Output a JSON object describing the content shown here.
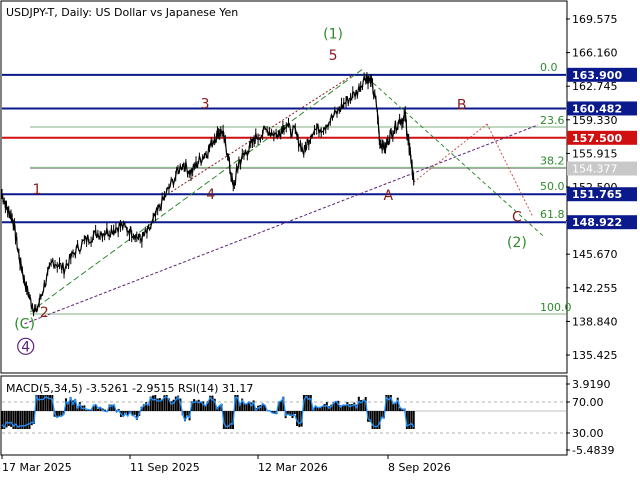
{
  "title": "USDJPY-T, Daily:  US Dollar vs Japanese Yen",
  "colors": {
    "navy": "#0a1a8c",
    "red": "#d01010",
    "green": "#2e8b2e",
    "darkred": "#8b1a1a",
    "purple": "#5b1f7a",
    "grey": "#8c8c8c",
    "price_line": "#000000",
    "macd_hist": "#000000",
    "rsi_line": "#1e90ff"
  },
  "chart_data": [
    {
      "type": "line",
      "name": "price",
      "x_ticks": [
        "17 Mar 2025",
        "11 Sep 2025",
        "12 Mar 2026",
        "8 Sep 2026"
      ],
      "y_ticks": [
        "169.575",
        "166.160",
        "162.745",
        "159.330",
        "155.915",
        "152.500",
        "149.085",
        "145.670",
        "142.255",
        "138.840",
        "135.425"
      ],
      "ylim": [
        133.7,
        171.3
      ],
      "y_axis_side": "right",
      "path": [
        [
          0,
          151.8
        ],
        [
          0.01,
          150.2
        ],
        [
          0.02,
          149.0
        ],
        [
          0.03,
          145.5
        ],
        [
          0.04,
          143.0
        ],
        [
          0.05,
          141.0
        ],
        [
          0.06,
          139.7
        ],
        [
          0.075,
          142.5
        ],
        [
          0.09,
          145.0
        ],
        [
          0.11,
          144.2
        ],
        [
          0.13,
          146.0
        ],
        [
          0.15,
          147.2
        ],
        [
          0.17,
          147.8
        ],
        [
          0.19,
          148.0
        ],
        [
          0.21,
          148.6
        ],
        [
          0.23,
          148.0
        ],
        [
          0.245,
          147.2
        ],
        [
          0.26,
          148.0
        ],
        [
          0.28,
          150.5
        ],
        [
          0.3,
          152.8
        ],
        [
          0.32,
          154.9
        ],
        [
          0.335,
          154.0
        ],
        [
          0.35,
          155.2
        ],
        [
          0.365,
          156.2
        ],
        [
          0.38,
          157.8
        ],
        [
          0.39,
          158.2
        ],
        [
          0.4,
          156.0
        ],
        [
          0.41,
          152.3
        ],
        [
          0.42,
          155.0
        ],
        [
          0.435,
          156.2
        ],
        [
          0.45,
          157.5
        ],
        [
          0.47,
          158.3
        ],
        [
          0.49,
          157.8
        ],
        [
          0.5,
          158.8
        ],
        [
          0.52,
          158.0
        ],
        [
          0.535,
          156.0
        ],
        [
          0.55,
          158.2
        ],
        [
          0.57,
          158.6
        ],
        [
          0.59,
          159.8
        ],
        [
          0.61,
          161.2
        ],
        [
          0.63,
          162.2
        ],
        [
          0.645,
          163.8
        ],
        [
          0.655,
          163.1
        ],
        [
          0.665,
          160.5
        ],
        [
          0.67,
          157.0
        ],
        [
          0.68,
          156.5
        ],
        [
          0.69,
          158.0
        ],
        [
          0.705,
          159.3
        ],
        [
          0.715,
          159.6
        ],
        [
          0.72,
          157.2
        ],
        [
          0.725,
          155.5
        ],
        [
          0.73,
          153.0
        ]
      ],
      "levels": [
        {
          "value": 163.9,
          "label": "163.900",
          "color": "navy",
          "fib": "0.0"
        },
        {
          "value": 160.482,
          "label": "160.482",
          "color": "navy",
          "fib": ""
        },
        {
          "value": 157.5,
          "label": "157.500",
          "color": "red",
          "fib": ""
        },
        {
          "value": 151.765,
          "label": "151.765",
          "color": "navy",
          "fib": "50.0"
        },
        {
          "value": 148.922,
          "label": "148.922",
          "color": "navy",
          "fib": "61.8"
        }
      ],
      "fib_only": [
        {
          "value": 158.6,
          "fib": "23.6"
        },
        {
          "value": 154.5,
          "fib": "38.2"
        },
        {
          "value": 139.6,
          "fib": "100.0"
        }
      ],
      "current_price": {
        "value": 154.377,
        "label": "154.377"
      },
      "wave_labels": [
        {
          "text": "1",
          "x": 0.062,
          "y": 151.8,
          "style": "red"
        },
        {
          "text": "2",
          "x": 0.075,
          "y": 139.3,
          "style": "red"
        },
        {
          "text": "3",
          "x": 0.36,
          "y": 160.5,
          "style": "red"
        },
        {
          "text": "4",
          "x": 0.37,
          "y": 151.3,
          "style": "red"
        },
        {
          "text": "5",
          "x": 0.587,
          "y": 165.4,
          "style": "red"
        },
        {
          "text": "(1)",
          "x": 0.587,
          "y": 167.6,
          "style": "green"
        },
        {
          "text": "(C)",
          "x": 0.04,
          "y": 138.1,
          "style": "green"
        },
        {
          "text": "4",
          "x": 0.042,
          "y": 135.8,
          "style": "purple"
        },
        {
          "text": "A",
          "x": 0.685,
          "y": 151.2,
          "style": "red"
        },
        {
          "text": "B",
          "x": 0.815,
          "y": 160.4,
          "style": "red"
        },
        {
          "text": "C",
          "x": 0.913,
          "y": 149.0,
          "style": "red"
        },
        {
          "text": "(2)",
          "x": 0.913,
          "y": 146.4,
          "style": "green"
        }
      ]
    },
    {
      "type": "area",
      "name": "indicator",
      "title": "MACD(5,34,5) -3.5261 -2.9515 RSI(14) 31.17",
      "y_ticks": [
        "3.9190",
        "70.00",
        "30.00",
        "-5.4839"
      ]
    }
  ]
}
